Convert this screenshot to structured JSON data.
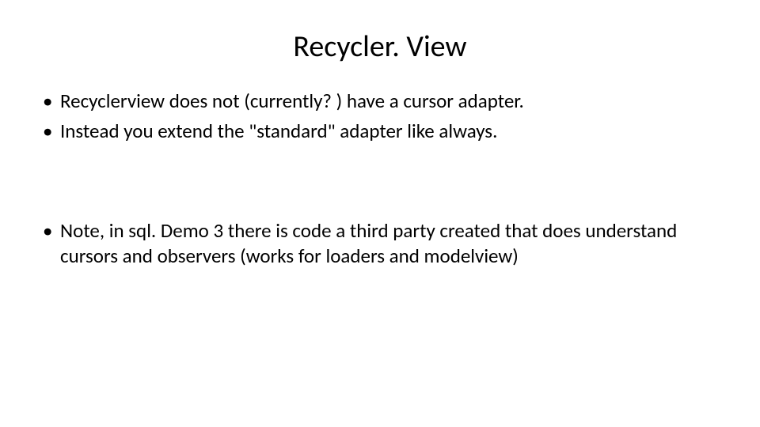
{
  "slide": {
    "title": "Recycler. View",
    "bullets_top": [
      "Recyclerview does not (currently? ) have a cursor adapter.",
      "Instead you extend the \"standard\" adapter like always."
    ],
    "bullets_bottom": [
      "Note, in sql. Demo 3 there is code a third party created that does understand cursors and observers (works for loaders and modelview)"
    ]
  }
}
